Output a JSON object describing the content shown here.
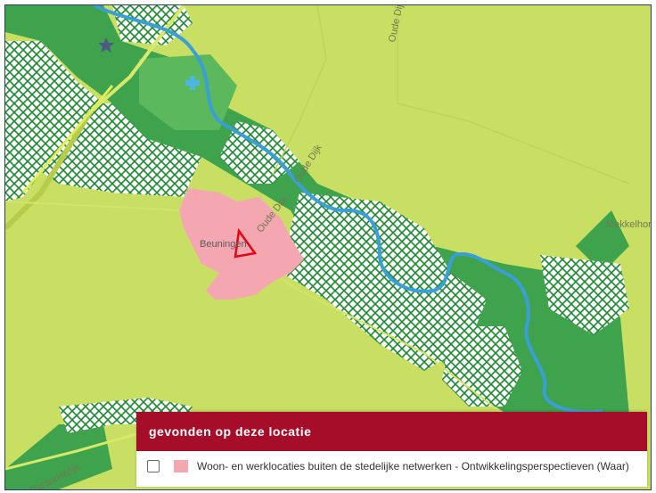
{
  "map": {
    "labels": {
      "oude_dijk_1": "Oude Dijk",
      "oude_dijk_2": "Oude Dijk",
      "oude_dijk_3": "Oude Dijk",
      "town": "Beuningen",
      "mekkelhorst": "Mekkelhors",
      "road_bottom": "Paranderdijk"
    },
    "colors": {
      "base": "#c9df63",
      "forest": "#3fa34d",
      "forest_light": "#5cb85c",
      "river": "#3a9fd6",
      "town": "#f4a7b0",
      "highlight": "#e30613",
      "hatch": "#1a8a2e"
    },
    "icons": [
      "star-icon",
      "cross-icon"
    ]
  },
  "panel": {
    "title": "gevonden op deze locatie",
    "items": [
      {
        "checked": false,
        "label": "Woon- en werklocaties buiten de stedelijke netwerken - Ontwikkelingsperspectieven (Waar)",
        "swatch": "#f4a7b0"
      }
    ]
  }
}
